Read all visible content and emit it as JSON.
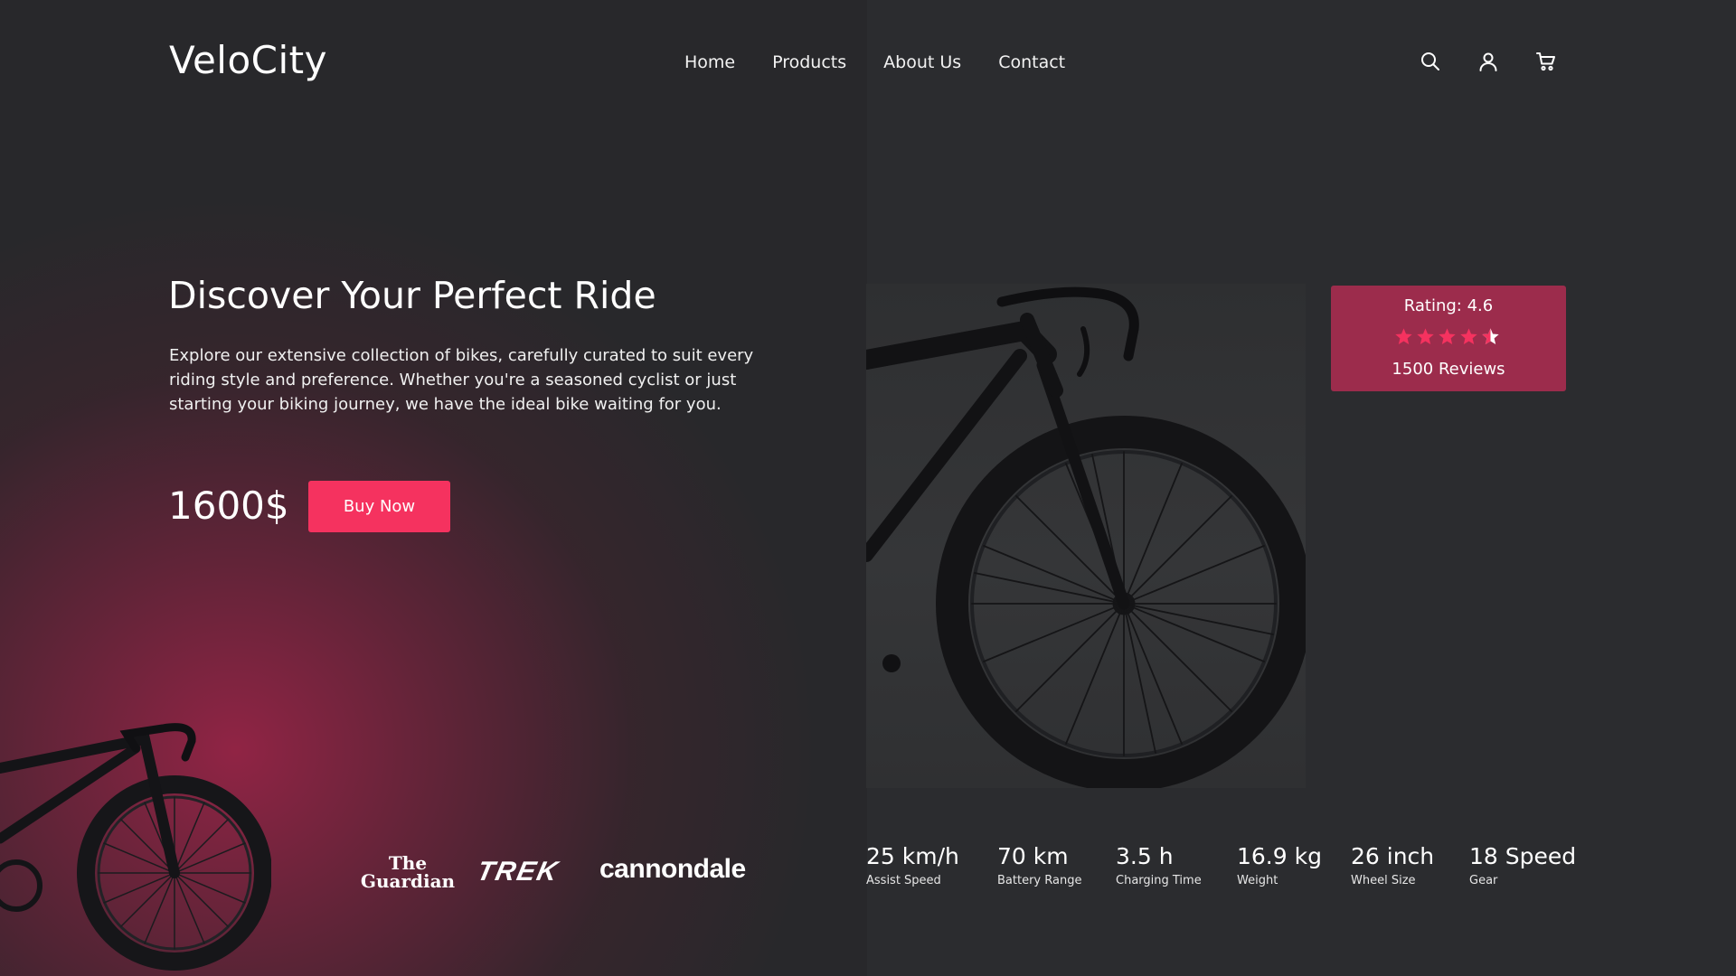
{
  "brand": {
    "name": "VeloCity"
  },
  "nav": {
    "items": [
      {
        "label": "Home"
      },
      {
        "label": "Products"
      },
      {
        "label": "About Us"
      },
      {
        "label": "Contact"
      }
    ]
  },
  "header_icons": [
    "search-icon",
    "user-icon",
    "cart-icon"
  ],
  "hero": {
    "title": "Discover Your Perfect Ride",
    "description": "Explore our extensive collection of bikes, carefully curated to suit every riding style and preference. Whether you're a seasoned cyclist or just starting your biking journey, we have the ideal bike waiting for you.",
    "price": "1600$",
    "buy_label": "Buy Now"
  },
  "partners": {
    "guardian_line1": "The",
    "guardian_line2": "Guardian",
    "trek": "TREK",
    "cannondale": "cannondale"
  },
  "rating": {
    "label": "Rating: 4.6",
    "value": 4.6,
    "max": 5,
    "reviews": "1500 Reviews"
  },
  "specs": [
    {
      "value": "25 km/h",
      "label": "Assist Speed"
    },
    {
      "value": "70 km",
      "label": "Battery Range"
    },
    {
      "value": "3.5 h",
      "label": "Charging Time"
    },
    {
      "value": "16.9 kg",
      "label": "Weight"
    },
    {
      "value": "26 inch",
      "label": "Wheel Size"
    },
    {
      "value": "18 Speed",
      "label": "Gear"
    }
  ],
  "colors": {
    "accent": "#f5325f",
    "rating_card": "#9c2c4c",
    "star": "#f5325f",
    "background": "#2a2b2e",
    "gradient": "#962446"
  }
}
